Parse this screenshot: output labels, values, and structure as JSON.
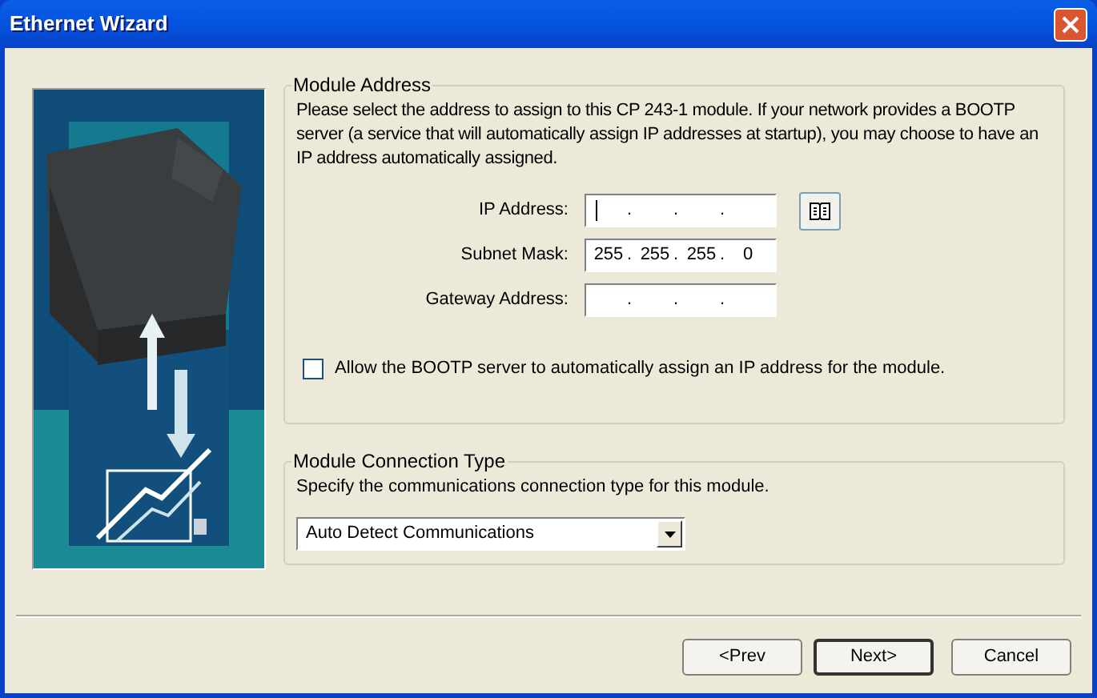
{
  "window": {
    "title": "Ethernet Wizard"
  },
  "module_address": {
    "title": "Module Address",
    "description": "Please select the address to assign to this CP 243-1  module. If your network provides a BOOTP server (a service that will automatically assign IP addresses at startup), you may choose to have an IP address automatically assigned.",
    "fields": [
      {
        "label": "IP Address:",
        "separator": ".",
        "focused": true,
        "lookup_button": true
      },
      {
        "label": "Subnet Mask:",
        "separator": ".",
        "focused": false,
        "octets": [
          "255",
          "255",
          "255",
          "0"
        ]
      },
      {
        "label": "Gateway Address:",
        "separator": ".",
        "focused": false
      }
    ],
    "bootp": {
      "label": "Allow the BOOTP server to automatically assign an IP address for the module.",
      "checked": false
    }
  },
  "connection_type": {
    "title": "Module Connection Type",
    "description": "Specify the communications connection type for this module.",
    "value": "Auto Detect Communications"
  },
  "buttons": [
    {
      "label": "<Prev",
      "default": false
    },
    {
      "label": "Next>",
      "default": true
    },
    {
      "label": "Cancel",
      "default": false
    }
  ]
}
